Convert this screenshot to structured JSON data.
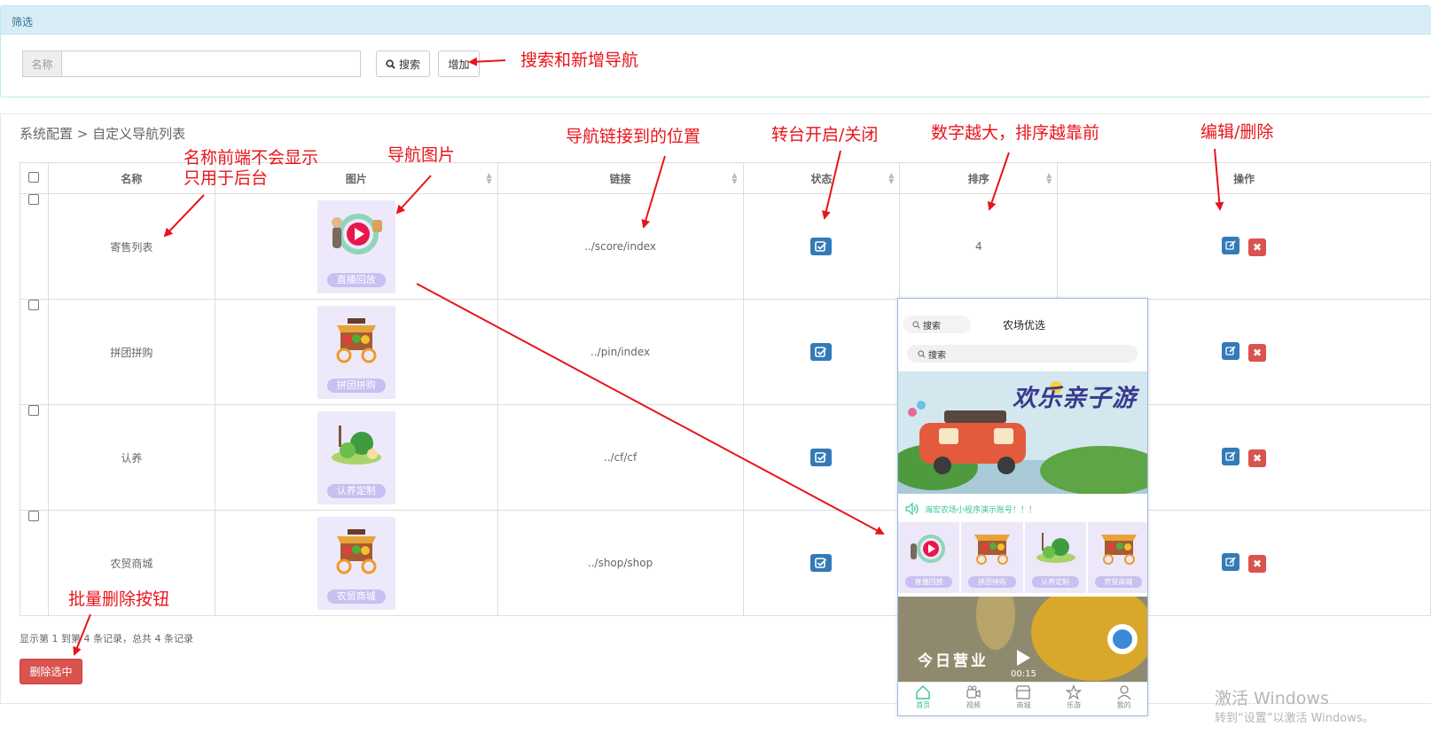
{
  "filter": {
    "title": "筛选",
    "name_label": "名称",
    "name_value": "",
    "search_button": "搜索",
    "add_button": "增加"
  },
  "breadcrumb": "系统配置 > 自定义导航列表",
  "table": {
    "headers": [
      "名称",
      "图片",
      "链接",
      "状态",
      "排序",
      "操作"
    ],
    "rows": [
      {
        "name": "寄售列表",
        "image_label": "直播回放",
        "link": "../score/index",
        "status": "on",
        "sort": "4"
      },
      {
        "name": "拼团拼购",
        "image_label": "拼团拼购",
        "link": "../pin/index",
        "status": "on",
        "sort": ""
      },
      {
        "name": "认养",
        "image_label": "认养定制",
        "link": "../cf/cf",
        "status": "on",
        "sort": ""
      },
      {
        "name": "农贸商城",
        "image_label": "农贸商城",
        "link": "../shop/shop",
        "status": "on",
        "sort": ""
      }
    ]
  },
  "summary": "显示第 1 到第 4 条记录，总共 4 条记录",
  "batch_delete_button": "删除选中",
  "annotations": {
    "search_add": "搜索和新增导航",
    "name_note_1": "名称前端不会显示",
    "name_note_2": "只用于后台",
    "nav_image": "导航图片",
    "link_pos": "导航链接到的位置",
    "status_toggle": "转台开启/关闭",
    "sort_note": "数字越大，排序越靠前",
    "edit_delete": "编辑/删除",
    "batch_delete": "批量删除按钮"
  },
  "phone": {
    "search1": "搜索",
    "title": "农场优选",
    "search2": "搜索",
    "banner_title": "欢乐亲子游",
    "notice": "海宏农场小程序演示账号！！！",
    "navs": [
      "直播回放",
      "拼团拼购",
      "认养定制",
      "农贸商城"
    ],
    "video_text": "今日营业",
    "video_time": "00:15",
    "tabs": [
      "首页",
      "视频",
      "商城",
      "乐游",
      "我的"
    ]
  },
  "watermark": {
    "line1": "激活 Windows",
    "line2": "转到“设置”以激活 Windows。"
  },
  "colors": {
    "primary": "#337ab7",
    "danger": "#d9534f",
    "annotation": "#e8141b",
    "panel_head": "#d9edf7"
  }
}
